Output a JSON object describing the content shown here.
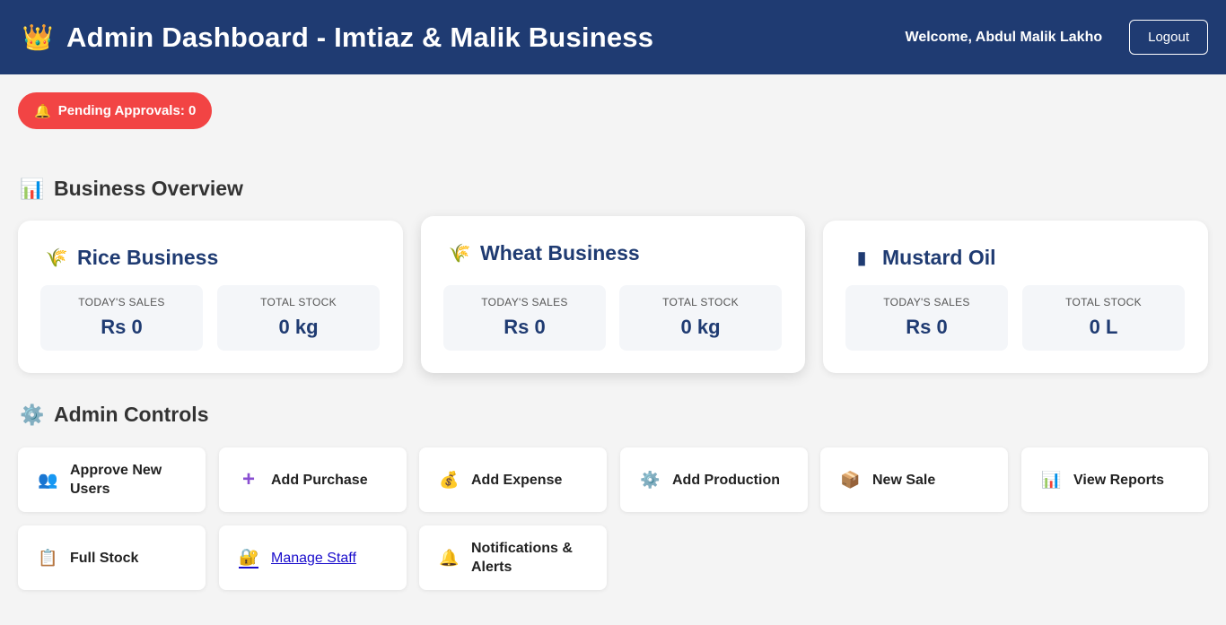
{
  "header": {
    "logo_icon": "crown-icon",
    "title": "Admin Dashboard - Imtiaz & Malik Business",
    "welcome": "Welcome, Abdul Malik Lakho",
    "logout": "Logout"
  },
  "pending": {
    "icon": "bell-icon",
    "label": "Pending Approvals: 0"
  },
  "overview": {
    "icon": "bar-chart-icon",
    "title": "Business Overview",
    "cards": [
      {
        "icon": "wheat-icon",
        "title": "Rice Business",
        "sales_label": "TODAY'S SALES",
        "sales_value": "Rs 0",
        "stock_label": "TOTAL STOCK",
        "stock_value": "0 kg"
      },
      {
        "icon": "wheat-icon",
        "title": "Wheat Business",
        "sales_label": "TODAY'S SALES",
        "sales_value": "Rs 0",
        "stock_label": "TOTAL STOCK",
        "stock_value": "0 kg"
      },
      {
        "icon": "oil-can-icon",
        "title": "Mustard Oil",
        "sales_label": "TODAY'S SALES",
        "sales_value": "Rs 0",
        "stock_label": "TOTAL STOCK",
        "stock_value": "0 L"
      }
    ]
  },
  "controls": {
    "icon": "gear-icon",
    "title": "Admin Controls",
    "items": [
      {
        "icon": "users-icon",
        "label": "Approve New Users"
      },
      {
        "icon": "plus-icon",
        "label": "Add Purchase"
      },
      {
        "icon": "money-bag-icon",
        "label": "Add Expense"
      },
      {
        "icon": "gear-icon",
        "label": "Add Production"
      },
      {
        "icon": "package-icon",
        "label": "New Sale"
      },
      {
        "icon": "bar-chart-icon",
        "label": "View Reports"
      },
      {
        "icon": "clipboard-icon",
        "label": "Full Stock"
      },
      {
        "icon": "lock-key-icon",
        "label": "Manage Staff"
      },
      {
        "icon": "bell-icon",
        "label": "Notifications & Alerts"
      }
    ]
  },
  "colors": {
    "header_bg": "#1f3b72",
    "accent": "#1f3b72",
    "alert": "#f24444",
    "page_bg": "#f4f4f4"
  }
}
